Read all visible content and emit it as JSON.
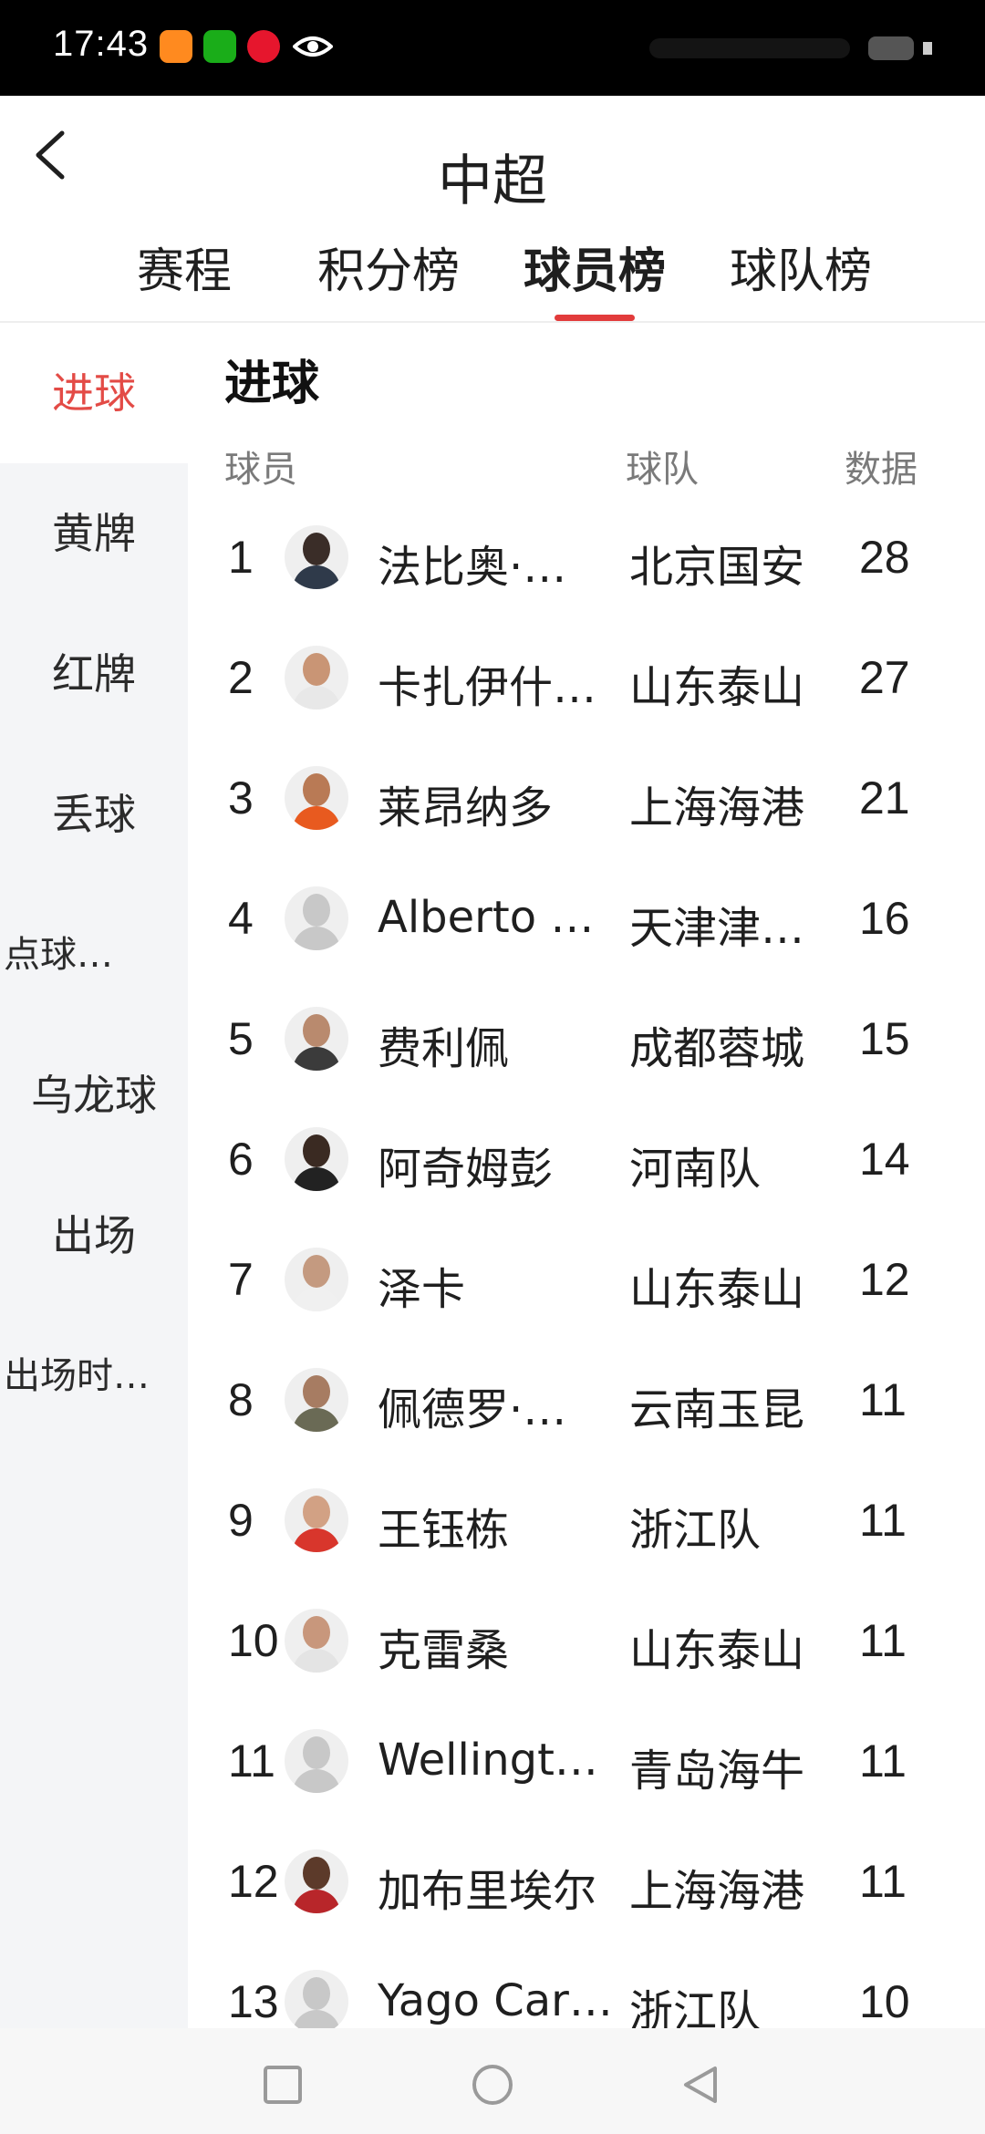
{
  "status_bar": {
    "time": "17:43"
  },
  "header": {
    "title": "中超"
  },
  "tabs": [
    {
      "label": "赛程",
      "active": false
    },
    {
      "label": "积分榜",
      "active": false
    },
    {
      "label": "球员榜",
      "active": true
    },
    {
      "label": "球队榜",
      "active": false
    }
  ],
  "colors": {
    "accent": "#e23b3b",
    "nav_bg": "#f4f5f7"
  },
  "sidebar": {
    "items": [
      {
        "label": "进球",
        "active": true
      },
      {
        "label": "黄牌",
        "active": false
      },
      {
        "label": "红牌",
        "active": false
      },
      {
        "label": "丢球",
        "active": false
      },
      {
        "label": "点球…",
        "active": false
      },
      {
        "label": "乌龙球",
        "active": false
      },
      {
        "label": "出场",
        "active": false
      },
      {
        "label": "出场时…",
        "active": false
      }
    ]
  },
  "main": {
    "section_title": "进球",
    "columns": {
      "player": "球员",
      "team": "球队",
      "data": "数据"
    },
    "rows": [
      {
        "rank": "1",
        "name": "法比奥·…",
        "team": "北京国安",
        "value": "28",
        "avatar": "player-photo"
      },
      {
        "rank": "2",
        "name": "卡扎伊什…",
        "team": "山东泰山",
        "value": "27",
        "avatar": "player-photo"
      },
      {
        "rank": "3",
        "name": "莱昂纳多",
        "team": "上海海港",
        "value": "21",
        "avatar": "player-photo"
      },
      {
        "rank": "4",
        "name": "Alberto …",
        "team": "天津津…",
        "value": "16",
        "avatar": "placeholder"
      },
      {
        "rank": "5",
        "name": "费利佩",
        "team": "成都蓉城",
        "value": "15",
        "avatar": "player-photo"
      },
      {
        "rank": "6",
        "name": "阿奇姆彭",
        "team": "河南队",
        "value": "14",
        "avatar": "player-photo"
      },
      {
        "rank": "7",
        "name": "泽卡",
        "team": "山东泰山",
        "value": "12",
        "avatar": "player-photo"
      },
      {
        "rank": "8",
        "name": "佩德罗·…",
        "team": "云南玉昆",
        "value": "11",
        "avatar": "player-photo"
      },
      {
        "rank": "9",
        "name": "王钰栋",
        "team": "浙江队",
        "value": "11",
        "avatar": "player-photo"
      },
      {
        "rank": "10",
        "name": "克雷桑",
        "team": "山东泰山",
        "value": "11",
        "avatar": "player-photo"
      },
      {
        "rank": "11",
        "name": "Wellingt…",
        "team": "青岛海牛",
        "value": "11",
        "avatar": "placeholder"
      },
      {
        "rank": "12",
        "name": "加布里埃尔",
        "team": "上海海港",
        "value": "11",
        "avatar": "player-photo"
      },
      {
        "rank": "13",
        "name": "Yago Car…",
        "team": "浙江队",
        "value": "10",
        "avatar": "placeholder"
      }
    ]
  },
  "system_nav": [
    "recents-button",
    "home-button",
    "back-nav-button"
  ]
}
